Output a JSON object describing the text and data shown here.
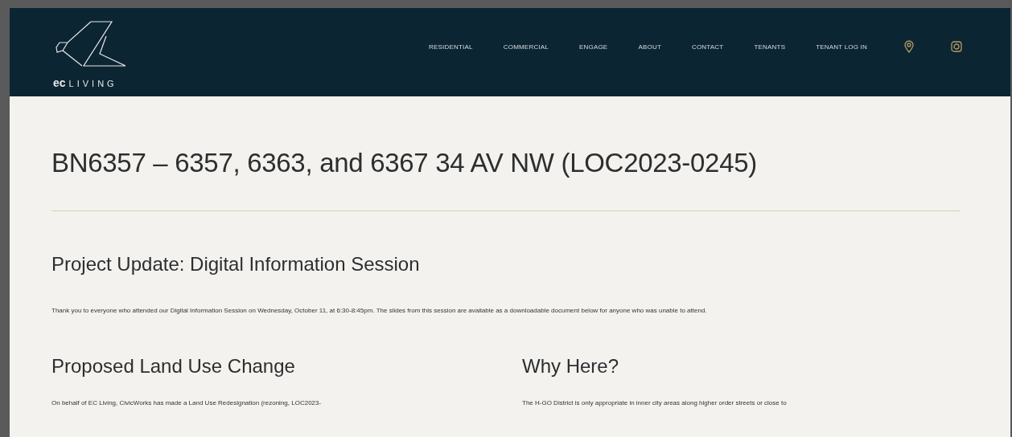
{
  "logo": {
    "brand": "ec",
    "name": "LIVING"
  },
  "nav": [
    {
      "label": "RESIDENTIAL"
    },
    {
      "label": "COMMERCIAL"
    },
    {
      "label": "ENGAGE"
    },
    {
      "label": "ABOUT"
    },
    {
      "label": "CONTACT"
    },
    {
      "label": "TENANTS"
    },
    {
      "label": "TENANT LOG IN"
    }
  ],
  "title": "BN6357 – 6357, 6363, and 6367 34 AV NW  (LOC2023-0245)",
  "update": {
    "heading": "Project Update: Digital Information Session",
    "text": "Thank you to everyone who attended our Digital Information Session on Wednesday, October 11, at 6:30-8:45pm. The slides from this session are available as a downloadable document below for anyone who was unable to attend."
  },
  "columns": [
    {
      "heading": "Proposed Land Use Change",
      "text": "On behalf of EC Living, CivicWorks has made a Land Use Redesignation (rezoning, LOC2023-"
    },
    {
      "heading": "Why Here?",
      "text": "The H-GO District is only appropriate in inner city areas along higher order streets or close to"
    }
  ]
}
